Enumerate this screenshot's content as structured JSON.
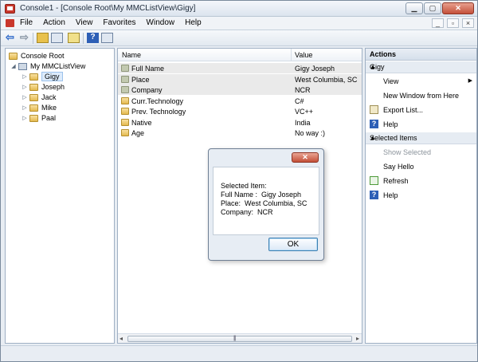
{
  "window": {
    "title": "Console1 - [Console Root\\My MMCListView\\Gigy]",
    "caption_minimize": "▁",
    "caption_maximize": "▢",
    "caption_close": "✕"
  },
  "menu": {
    "items": [
      "File",
      "Action",
      "View",
      "Favorites",
      "Window",
      "Help"
    ],
    "mdi_minimize": "_",
    "mdi_restore": "▫",
    "mdi_close": "×"
  },
  "toolbar": {
    "back_glyph": "⇦",
    "forward_glyph": "⇨",
    "help_glyph": "?"
  },
  "tree": {
    "root": "Console Root",
    "snapin": "My MMCListView",
    "nodes": [
      "Gigy",
      "Joseph",
      "Jack",
      "Mike",
      "Paal"
    ],
    "selected": "Gigy",
    "expander_collapsed": "▷",
    "expander_expanded": "◢"
  },
  "list": {
    "columns": [
      "Name",
      "Value"
    ],
    "rows": [
      {
        "name": "Full Name",
        "value": "Gigy Joseph",
        "icon": "grey",
        "shaded": true
      },
      {
        "name": "Place",
        "value": "West Columbia, SC",
        "icon": "grey",
        "shaded": true
      },
      {
        "name": "Company",
        "value": "NCR",
        "icon": "grey",
        "shaded": true
      },
      {
        "name": "Curr.Technology",
        "value": "C#",
        "icon": "yellow",
        "shaded": false
      },
      {
        "name": "Prev. Technology",
        "value": "VC++",
        "icon": "yellow",
        "shaded": false
      },
      {
        "name": "Native",
        "value": "India",
        "icon": "yellow",
        "shaded": false
      },
      {
        "name": "Age",
        "value": "No way :)",
        "icon": "yellow",
        "shaded": false
      }
    ],
    "scroll_left": "◂",
    "scroll_right": "▸",
    "scroll_grip": "|||"
  },
  "actions": {
    "header": "Actions",
    "section1": "Gigy",
    "section1_items": [
      {
        "label": "View",
        "submenu": true,
        "icon": ""
      },
      {
        "label": "New Window from Here",
        "submenu": false,
        "icon": ""
      },
      {
        "label": "Export List...",
        "submenu": false,
        "icon": "export"
      },
      {
        "label": "Help",
        "submenu": false,
        "icon": "help"
      }
    ],
    "section2": "Selected Items",
    "section2_items": [
      {
        "label": "Show Selected",
        "disabled": true,
        "icon": ""
      },
      {
        "label": "Say Hello",
        "disabled": false,
        "icon": ""
      },
      {
        "label": "Refresh",
        "disabled": false,
        "icon": "refresh"
      },
      {
        "label": "Help",
        "disabled": false,
        "icon": "help"
      }
    ],
    "section_arrow": "▲",
    "submenu_arrow": "▶"
  },
  "dialog": {
    "close_glyph": "✕",
    "message": "Selected Item:\nFull Name :  Gigy Joseph\nPlace:  West Columbia, SC\nCompany:  NCR",
    "ok_label": "OK"
  }
}
